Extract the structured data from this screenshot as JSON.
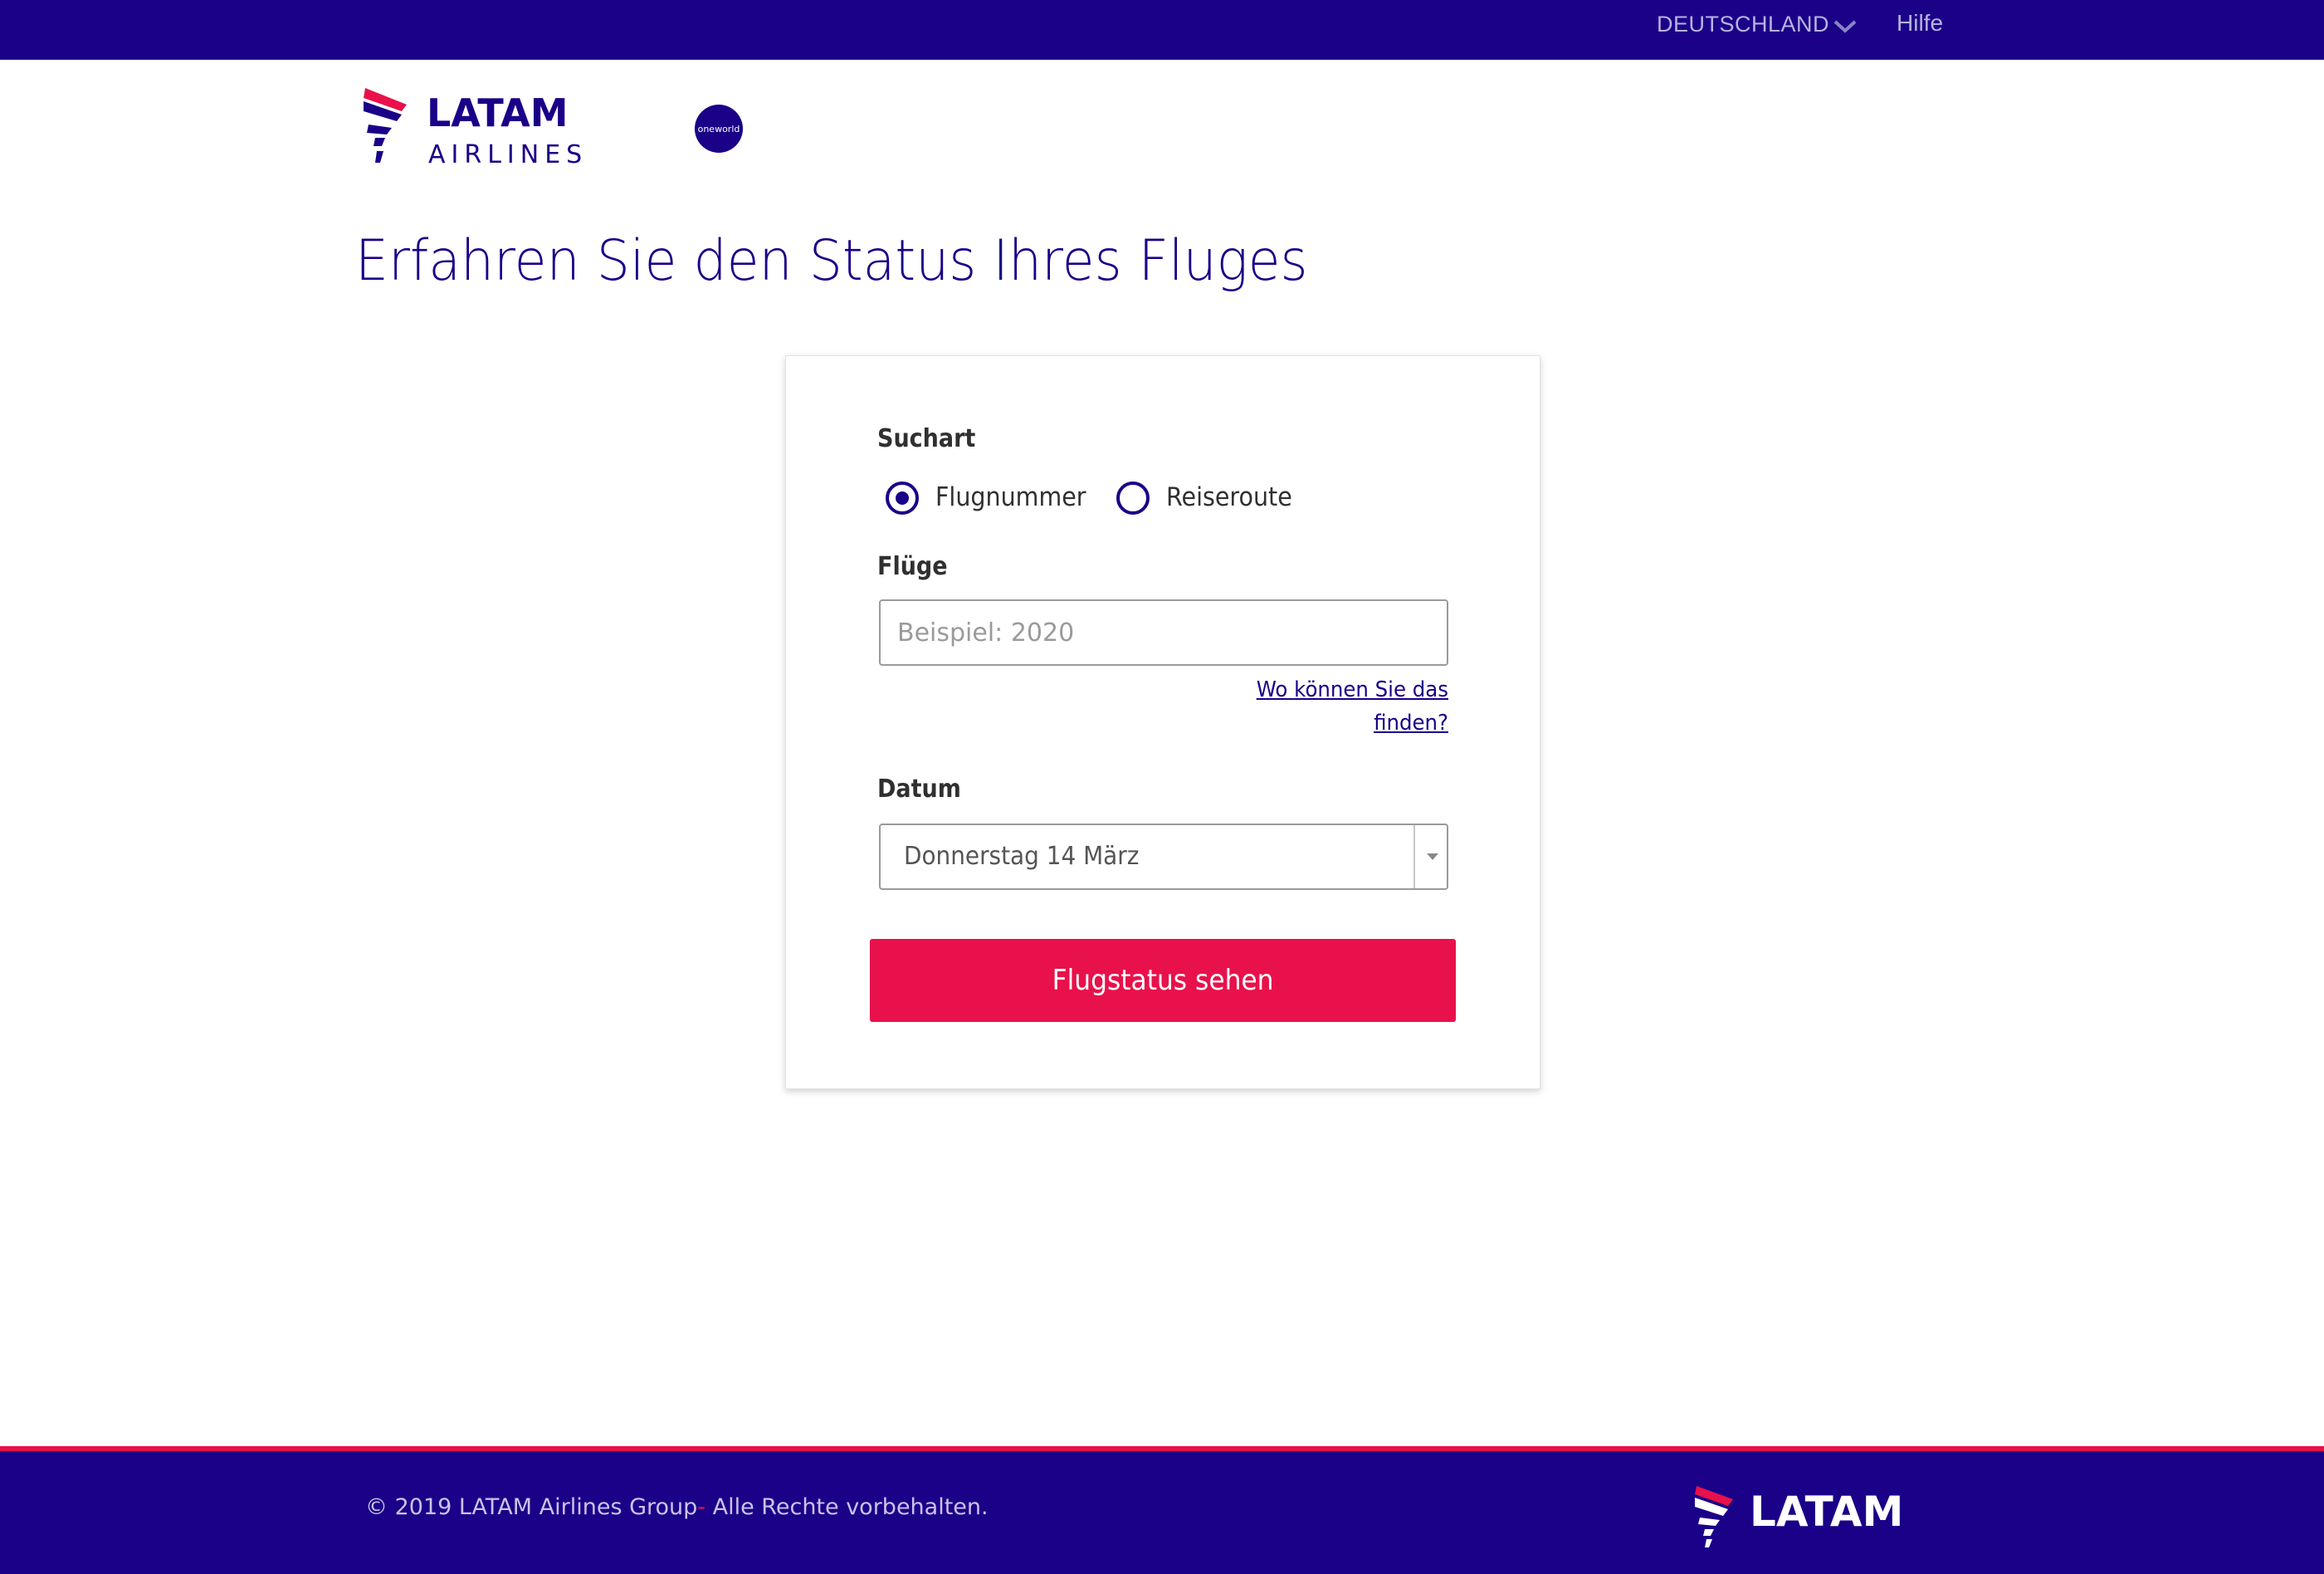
{
  "topbar": {
    "country": "DEUTSCHLAND",
    "help": "Hilfe"
  },
  "header": {
    "logo_text_main": "LATAM",
    "logo_text_sub": "AIRLINES",
    "alliance_badge": "oneworld"
  },
  "page_title": "Erfahren Sie den Status Ihres Fluges",
  "form": {
    "search_type_label": "Suchart",
    "options": [
      {
        "label": "Flugnummer",
        "checked": true
      },
      {
        "label": "Reiseroute",
        "checked": false
      }
    ],
    "flights_label": "Flüge",
    "flight_input_value": "",
    "flight_input_placeholder": "Beispiel: 2020",
    "help_link": "Wo können Sie das finden?",
    "date_label": "Datum",
    "date_value": "Donnerstag 14 März",
    "submit_label": "Flugstatus sehen"
  },
  "footer": {
    "copyright_main": "© 2019 LATAM Airlines Group",
    "copyright_sep": "-",
    "copyright_rights": " Alle Rechte vorbehalten.",
    "logo_text": "LATAM"
  },
  "colors": {
    "brand_indigo": "#1b0088",
    "brand_coral": "#e8114b"
  },
  "icons": [
    "chevron-down-icon",
    "latam-logo",
    "oneworld-logo",
    "radio-selected",
    "radio-unselected",
    "dropdown-arrow-icon"
  ]
}
